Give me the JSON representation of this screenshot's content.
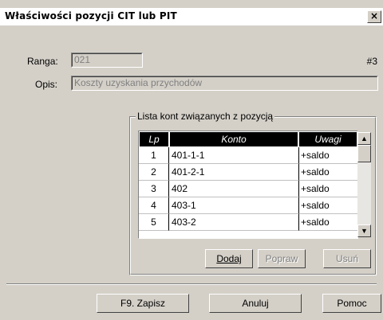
{
  "window": {
    "title": "Właściwości pozycji CIT lub PIT",
    "close_glyph": "×"
  },
  "form": {
    "ranga_label": "Ranga:",
    "ranga_value": "021",
    "record_index": "#3",
    "opis_label": "Opis:",
    "opis_value": "Koszty uzyskania przychodów"
  },
  "group": {
    "title": "Lista kont związanych z pozycją",
    "columns": [
      "Lp",
      "Konto",
      "Uwagi"
    ],
    "rows": [
      {
        "lp": "1",
        "konto": "401-1-1",
        "uwagi": "+saldo"
      },
      {
        "lp": "2",
        "konto": "401-2-1",
        "uwagi": "+saldo"
      },
      {
        "lp": "3",
        "konto": "402",
        "uwagi": "+saldo"
      },
      {
        "lp": "4",
        "konto": "403-1",
        "uwagi": "+saldo"
      },
      {
        "lp": "5",
        "konto": "403-2",
        "uwagi": "+saldo"
      }
    ],
    "buttons": {
      "add": "Dodaj",
      "edit": "Popraw",
      "delete": "Usuń"
    }
  },
  "footer": {
    "save": "F9. Zapisz",
    "cancel": "Anuluj",
    "help": "Pomoc"
  }
}
